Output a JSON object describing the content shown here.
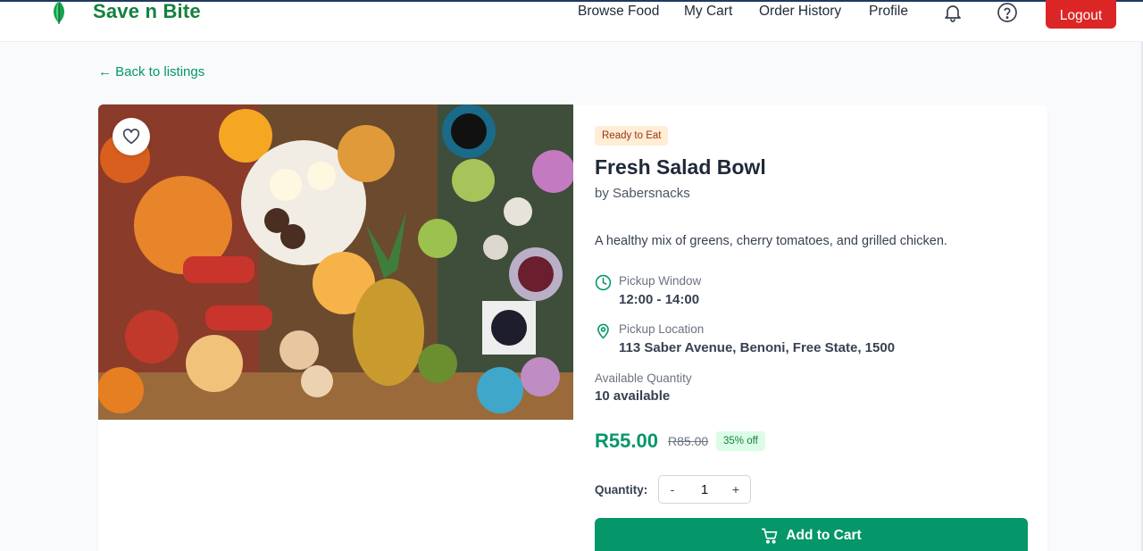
{
  "brand": {
    "name": "Save n Bite",
    "color": "#15803d"
  },
  "nav": {
    "links": [
      "Browse Food",
      "My Cart",
      "Order History",
      "Profile"
    ],
    "icons": [
      "bell-icon",
      "help-icon"
    ],
    "logout_label": "Logout"
  },
  "back_link": "← Back to listings",
  "listing": {
    "badge": "Ready to Eat",
    "title": "Fresh Salad Bowl",
    "vendor": "by Sabersnacks",
    "description": "A healthy mix of greens, cherry tomatoes, and grilled chicken.",
    "pickup_window_label": "Pickup Window",
    "pickup_window": "12:00 - 14:00",
    "pickup_location_label": "Pickup Location",
    "pickup_location": "113 Saber Avenue, Benoni, Free State, 1500",
    "available_label": "Available Quantity",
    "available": "10 available",
    "price": "R55.00",
    "original_price": "R85.00",
    "discount": "35% off",
    "quantity_label": "Quantity:",
    "quantity": "1",
    "decrement": "-",
    "increment": "+",
    "add_to_cart": "Add to Cart"
  },
  "colors": {
    "accent": "#059669",
    "danger": "#dc2626",
    "badge_bg": "#ffedd5",
    "discount_bg": "#dcfce7"
  }
}
